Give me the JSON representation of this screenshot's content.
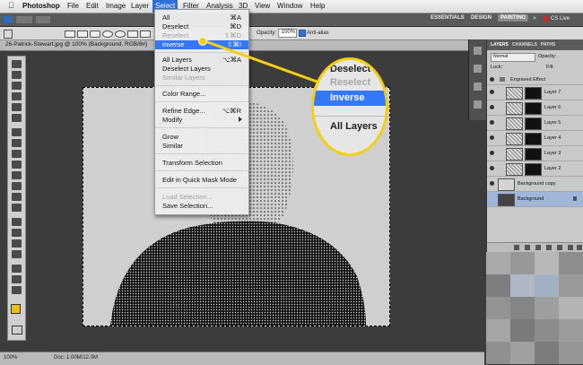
{
  "menubar": {
    "apple": "",
    "items": [
      "Photoshop",
      "File",
      "Edit",
      "Image",
      "Layer",
      "Select",
      "Filter",
      "Analysis",
      "3D",
      "View",
      "Window",
      "Help"
    ],
    "active": "Select"
  },
  "appbar": {
    "workspaces": [
      "ESSENTIALS",
      "DESIGN",
      "PAINTING"
    ],
    "active_workspace": "PAINTING",
    "cs_live": "CS Live"
  },
  "options": {
    "opacity_label": "Opacity:",
    "opacity_value": "100%",
    "antialias_label": "Anti-alias"
  },
  "document": {
    "tab_title": "26-Patrick-Stewart.jpg @ 100% (Background, RGB/8#)",
    "status": "100%",
    "doc_info": "Doc: 1.00M/12.0M"
  },
  "select_menu": {
    "items": [
      {
        "label": "All",
        "shortcut": "⌘A",
        "state": "normal"
      },
      {
        "label": "Deselect",
        "shortcut": "⌘D",
        "state": "normal"
      },
      {
        "label": "Reselect",
        "shortcut": "⇧⌘D",
        "state": "disabled"
      },
      {
        "label": "Inverse",
        "shortcut": "⇧⌘I",
        "state": "highlight"
      },
      {
        "label": "All Layers",
        "shortcut": "⌥⌘A",
        "state": "normal"
      },
      {
        "label": "Deselect Layers",
        "shortcut": "",
        "state": "normal"
      },
      {
        "label": "Similar Layers",
        "shortcut": "",
        "state": "disabled"
      },
      {
        "label": "Color Range...",
        "shortcut": "",
        "state": "normal"
      },
      {
        "label": "Refine Edge...",
        "shortcut": "⌥⌘R",
        "state": "normal"
      },
      {
        "label": "Modify",
        "shortcut": "",
        "state": "submenu"
      },
      {
        "label": "Grow",
        "shortcut": "",
        "state": "normal"
      },
      {
        "label": "Similar",
        "shortcut": "",
        "state": "normal"
      },
      {
        "label": "Transform Selection",
        "shortcut": "",
        "state": "normal"
      },
      {
        "label": "Edit in Quick Mask Mode",
        "shortcut": "",
        "state": "normal"
      },
      {
        "label": "Load Selection...",
        "shortcut": "",
        "state": "disabled"
      },
      {
        "label": "Save Selection...",
        "shortcut": "",
        "state": "normal"
      }
    ]
  },
  "callout": {
    "lines": [
      "Deselect",
      "Reselect",
      "Inverse",
      "All Layers"
    ]
  },
  "layers_panel": {
    "tabs": [
      "LAYERS",
      "CHANNELS",
      "PATHS"
    ],
    "blend_mode": "Normal",
    "opacity_label": "Opacity:",
    "fill_label": "Fill:",
    "lock_label": "Lock:",
    "group_name": "Engraved Effect",
    "layers": [
      "Layer 7",
      "Layer 6",
      "Layer 5",
      "Layer 4",
      "Layer 3",
      "Layer 2"
    ],
    "bottom_layers": [
      "Background copy",
      "Background"
    ]
  },
  "colors": {
    "accent": "#3478f6",
    "callout": "#f4cf12",
    "foreground": "#f0c000"
  }
}
